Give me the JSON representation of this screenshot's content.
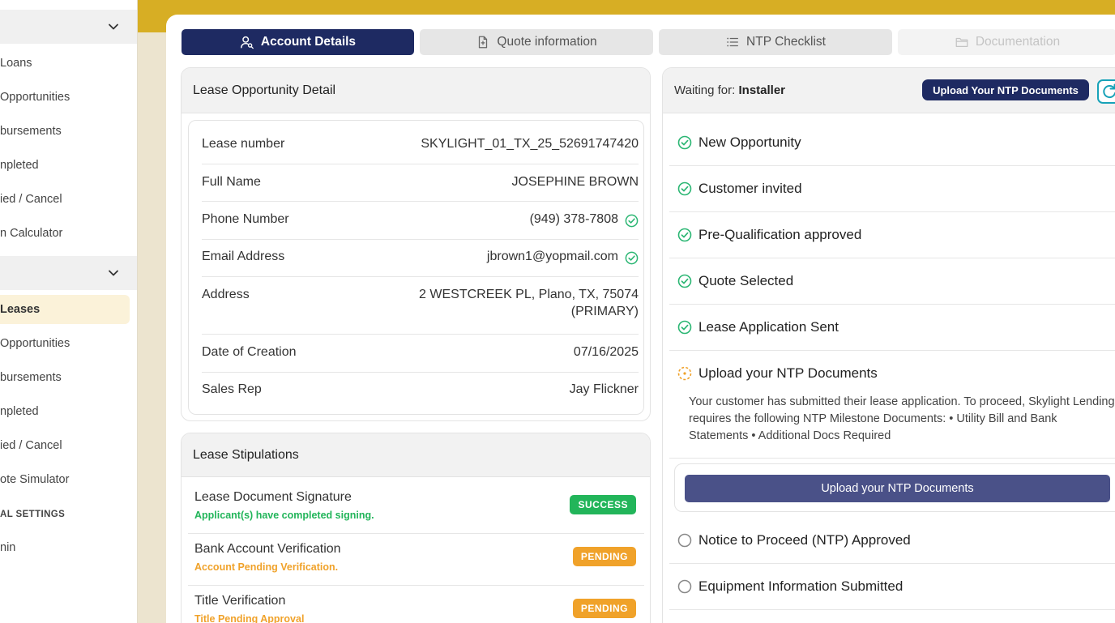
{
  "sidebar": {
    "groups": [
      {
        "items": [
          {
            "label": "Loans"
          },
          {
            "label": "Opportunities"
          },
          {
            "label": "bursements"
          },
          {
            "label": "npleted"
          },
          {
            "label": "ied / Cancel"
          },
          {
            "label": "n Calculator"
          }
        ]
      },
      {
        "items": [
          {
            "label": "Leases"
          },
          {
            "label": "Opportunities"
          },
          {
            "label": "bursements"
          },
          {
            "label": "npleted"
          },
          {
            "label": "ied / Cancel"
          },
          {
            "label": "ote Simulator"
          }
        ]
      }
    ],
    "section_heading": "AL SETTINGS",
    "settings_item": "nin"
  },
  "tabs": [
    {
      "label": "Account Details",
      "icon": "user-search-icon",
      "state": "active"
    },
    {
      "label": "Quote information",
      "icon": "document-icon",
      "state": "normal"
    },
    {
      "label": "NTP Checklist",
      "icon": "list-icon",
      "state": "normal"
    },
    {
      "label": "Documentation",
      "icon": "folder-icon",
      "state": "disabled"
    }
  ],
  "lease_detail": {
    "title": "Lease Opportunity Detail",
    "rows": [
      {
        "label": "Lease number",
        "value": "SKYLIGHT_01_TX_25_52691747420"
      },
      {
        "label": "Full Name",
        "value": "JOSEPHINE BROWN"
      },
      {
        "label": "Phone Number",
        "value": "(949) 378-7808",
        "verified": true
      },
      {
        "label": "Email Address",
        "value": "jbrown1@yopmail.com",
        "verified": true
      },
      {
        "label": "Address",
        "value_line1": "2 WESTCREEK PL, Plano, TX, 75074",
        "value_line2": "(PRIMARY)"
      },
      {
        "label": "Date of Creation",
        "value": "07/16/2025"
      },
      {
        "label": "Sales Rep",
        "value": "Jay Flickner"
      }
    ]
  },
  "stipulations": {
    "title": "Lease Stipulations",
    "items": [
      {
        "title": "Lease Document Signature",
        "subtitle": "Applicant(s) have completed signing.",
        "status": "SUCCESS",
        "color": "#22b55a"
      },
      {
        "title": "Bank Account Verification",
        "subtitle": "Account Pending Verification.",
        "status": "PENDING",
        "color": "#f0a22a"
      },
      {
        "title": "Title Verification",
        "subtitle": "Title Pending Approval",
        "status": "PENDING",
        "color": "#f0a22a"
      }
    ]
  },
  "milestones": {
    "waiting_label": "Waiting for:",
    "waiting_for": "Installer",
    "upload_button": "Upload Your NTP Documents",
    "items": [
      {
        "label": "New Opportunity",
        "status": "done"
      },
      {
        "label": "Customer invited",
        "status": "done"
      },
      {
        "label": "Pre-Qualification approved",
        "status": "done"
      },
      {
        "label": "Quote Selected",
        "status": "done"
      },
      {
        "label": "Lease Application Sent",
        "status": "done"
      },
      {
        "label": "Upload your NTP Documents",
        "status": "in-progress"
      },
      {
        "label": "Notice to Proceed (NTP) Approved",
        "status": "todo"
      },
      {
        "label": "Equipment Information Submitted",
        "status": "todo"
      }
    ],
    "ntp_description": "Your customer has submitted their lease application. To proceed, Skylight Lending requires the following NTP Milestone Documents: • Utility Bill and Bank Statements • Additional Docs Required",
    "ntp_button": "Upload your NTP Documents"
  },
  "colors": {
    "navy": "#1e2a62",
    "gold": "#d7ae24",
    "success": "#22b55a",
    "pending": "#f0a22a",
    "check_green": "#2bb673"
  }
}
